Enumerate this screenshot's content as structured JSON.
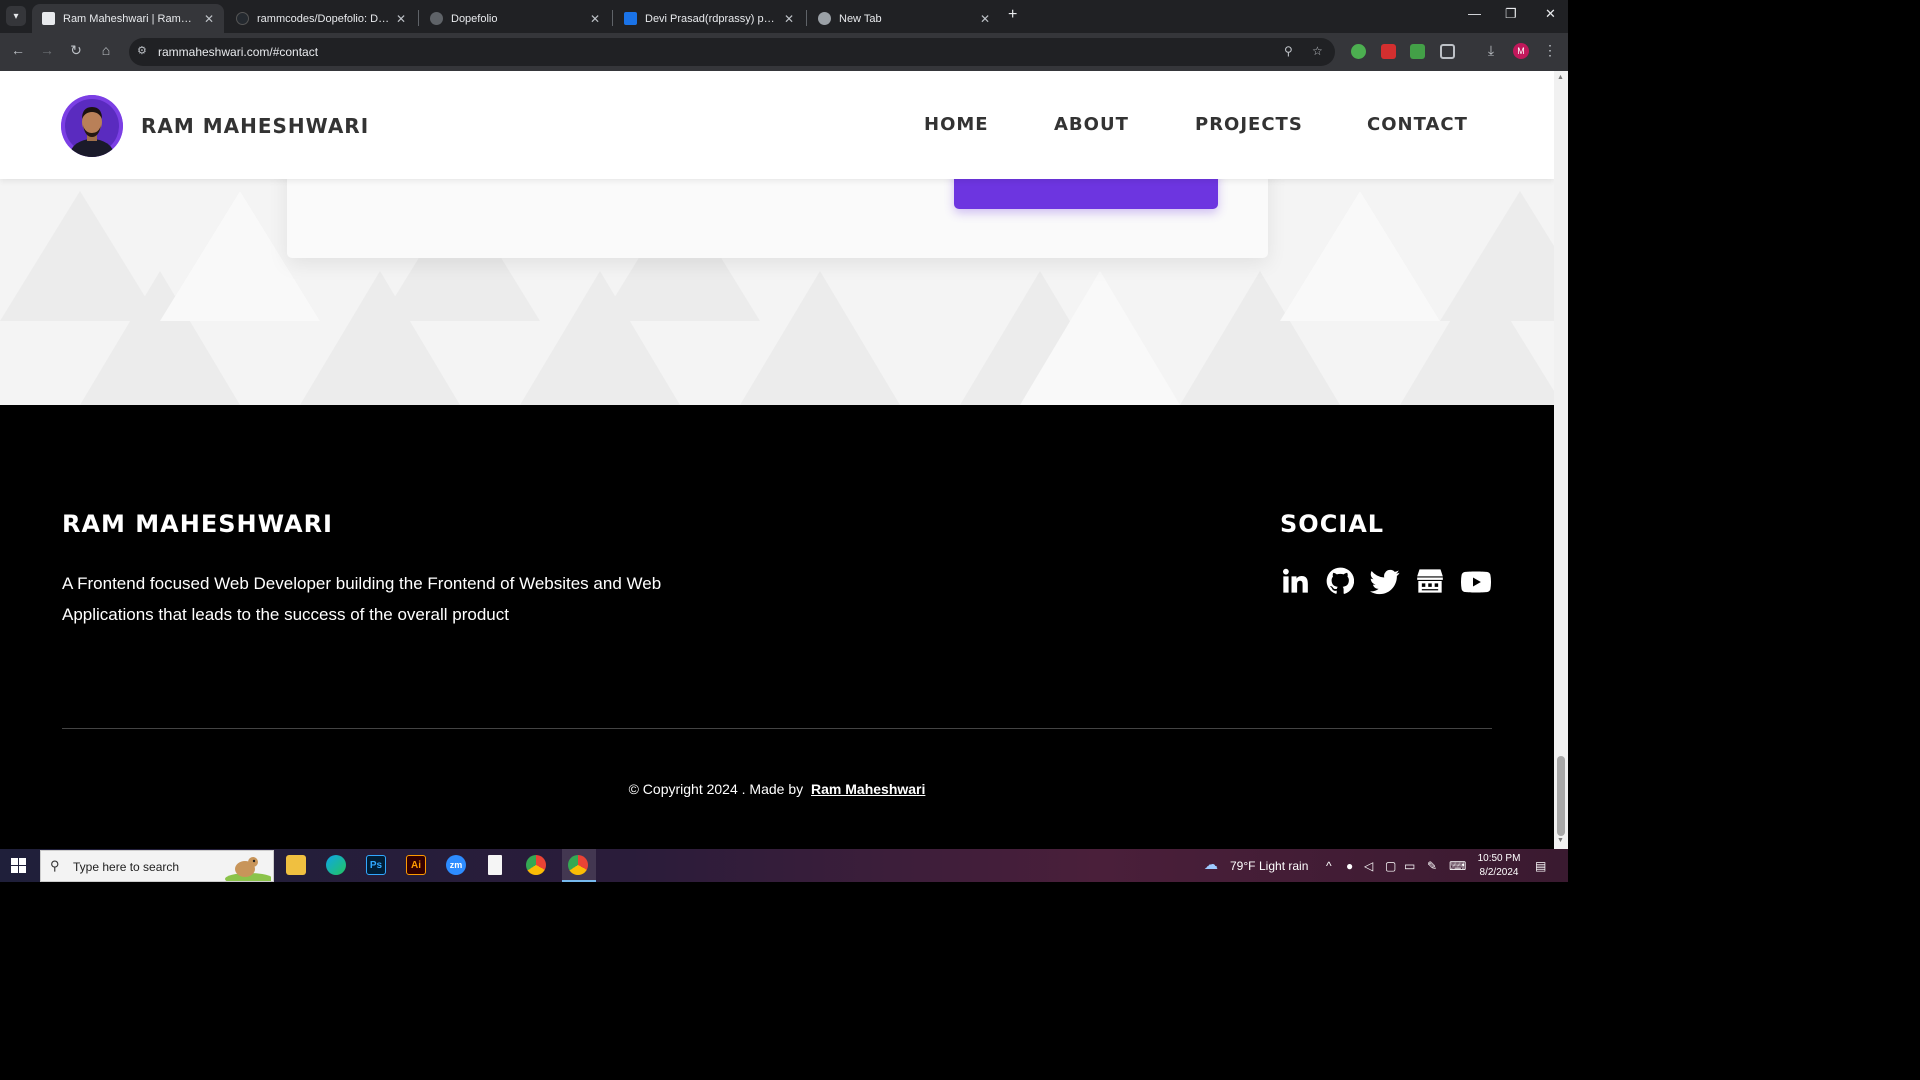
{
  "browser": {
    "tabs": [
      {
        "title": "Ram Maheshwari | RammCodes",
        "active": true
      },
      {
        "title": "rammcodes/Dopefolio: Dopefolio",
        "active": false
      },
      {
        "title": "Dopefolio",
        "active": false
      },
      {
        "title": "Devi Prasad(rdprassy) portfolio",
        "active": false
      },
      {
        "title": "New Tab",
        "active": false
      }
    ],
    "url": "rammaheshwari.com/#contact",
    "profile_initial": "M"
  },
  "header": {
    "brand": "RAM MAHESHWARI",
    "nav": [
      "HOME",
      "ABOUT",
      "PROJECTS",
      "CONTACT"
    ]
  },
  "footer": {
    "name": "RAM MAHESHWARI",
    "description": "A Frontend focused Web Developer building the Frontend of Websites and Web Applications that leads to the success of the overall product",
    "social_title": "SOCIAL",
    "social_icons": [
      "linkedin-icon",
      "github-icon",
      "twitter-icon",
      "shop-icon",
      "youtube-icon"
    ],
    "copyright_prefix": "© Copyright 2024 . Made by",
    "copyright_author": "Ram Maheshwari"
  },
  "taskbar": {
    "search_placeholder": "Type here to search",
    "weather_temp": "79°F",
    "weather_text": "Light rain",
    "time": "10:50 PM",
    "date": "8/2/2024"
  },
  "colors": {
    "accent": "#6d35e0",
    "footer_bg": "#000000"
  }
}
